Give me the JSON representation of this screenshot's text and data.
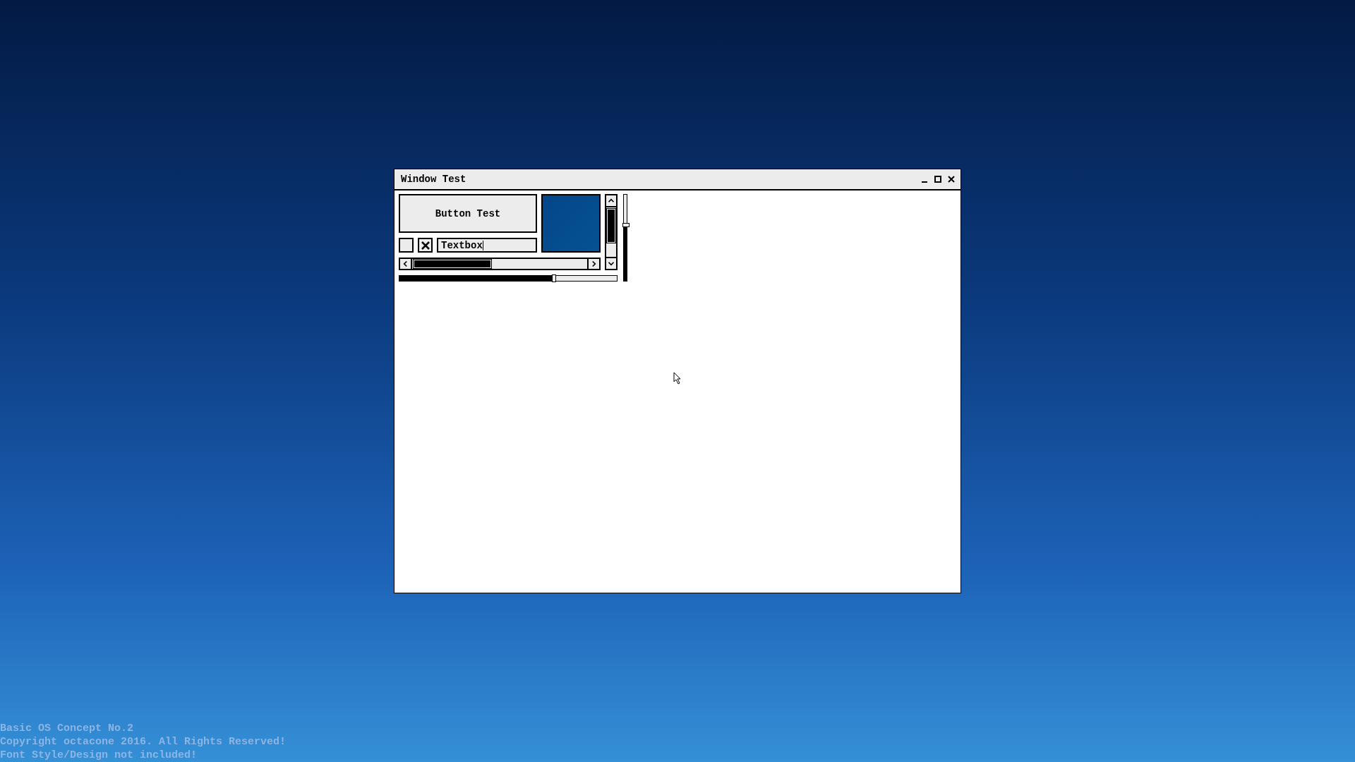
{
  "window": {
    "title": "Window Test"
  },
  "button": {
    "label": "Button Test"
  },
  "checkboxes": [
    {
      "checked": false
    },
    {
      "checked": true
    }
  ],
  "textbox": {
    "value": "Textbox",
    "focused": true
  },
  "sliders": [
    {
      "kind": "horizontal",
      "level": 0.71
    },
    {
      "kind": "vertical",
      "level": 0.65
    }
  ],
  "footer": [
    "Basic OS Concept No.2",
    "Copyright octacone 2016. All Rights Reserved!",
    "Font Style/Design not included!"
  ]
}
